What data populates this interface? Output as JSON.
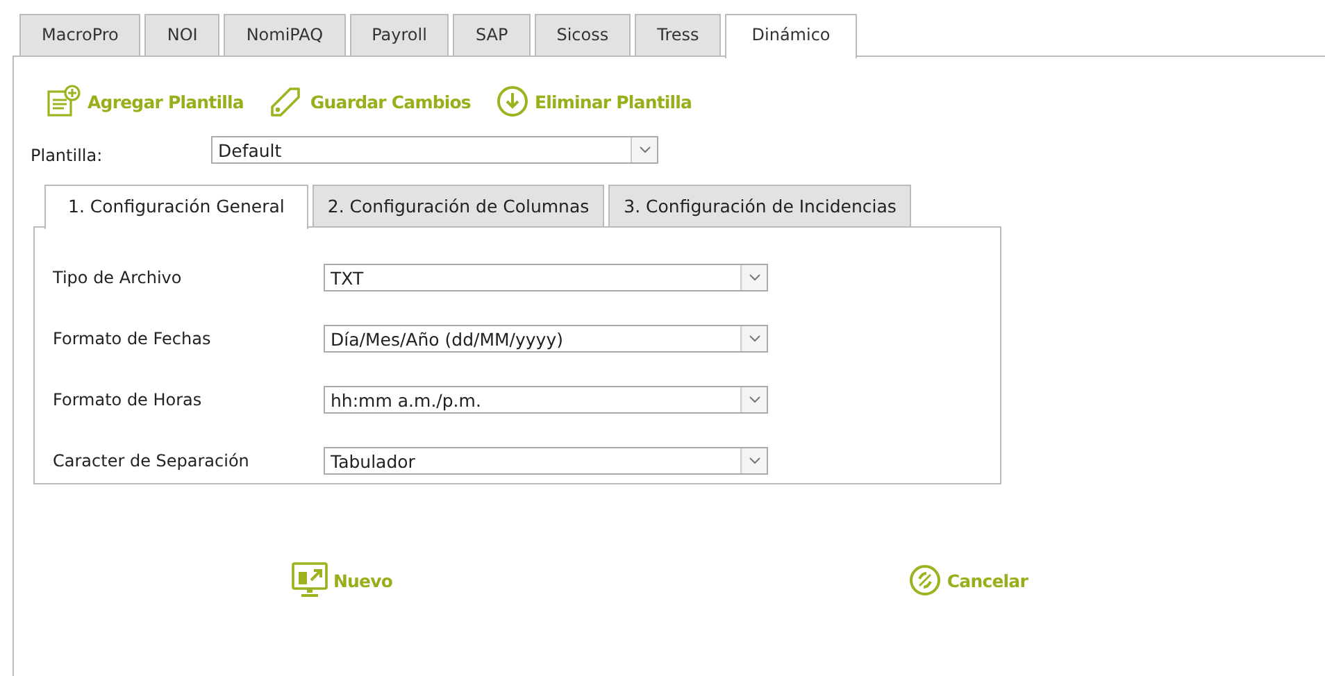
{
  "tabs": [
    {
      "label": "MacroPro",
      "selected": false
    },
    {
      "label": "NOI",
      "selected": false
    },
    {
      "label": "NomiPAQ",
      "selected": false
    },
    {
      "label": "Payroll",
      "selected": false
    },
    {
      "label": "SAP",
      "selected": false
    },
    {
      "label": "Sicoss",
      "selected": false
    },
    {
      "label": "Tress",
      "selected": false
    },
    {
      "label": "Dinámico",
      "selected": true
    }
  ],
  "toolbar": [
    {
      "kind": "add",
      "label": "Agregar Plantilla"
    },
    {
      "kind": "save",
      "label": "Guardar Cambios"
    },
    {
      "kind": "delete",
      "label": "Eliminar Plantilla"
    }
  ],
  "template": {
    "label": "Plantilla:",
    "value": "Default"
  },
  "subtabs": [
    {
      "label": "1. Configuración General",
      "selected": true
    },
    {
      "label": "2. Configuración de Columnas",
      "selected": false
    },
    {
      "label": "3. Configuración de Incidencias",
      "selected": false
    }
  ],
  "fields": [
    {
      "label": "Tipo de Archivo",
      "value": "TXT"
    },
    {
      "label": "Formato de Fechas",
      "value": "Día/Mes/Año  (dd/MM/yyyy)"
    },
    {
      "label": "Formato de Horas",
      "value": "hh:mm a.m./p.m."
    },
    {
      "label": "Caracter de Separación",
      "value": "Tabulador"
    }
  ],
  "actions": [
    {
      "kind": "new",
      "label": "Nuevo"
    },
    {
      "kind": "cancel",
      "label": "Cancelar"
    }
  ]
}
